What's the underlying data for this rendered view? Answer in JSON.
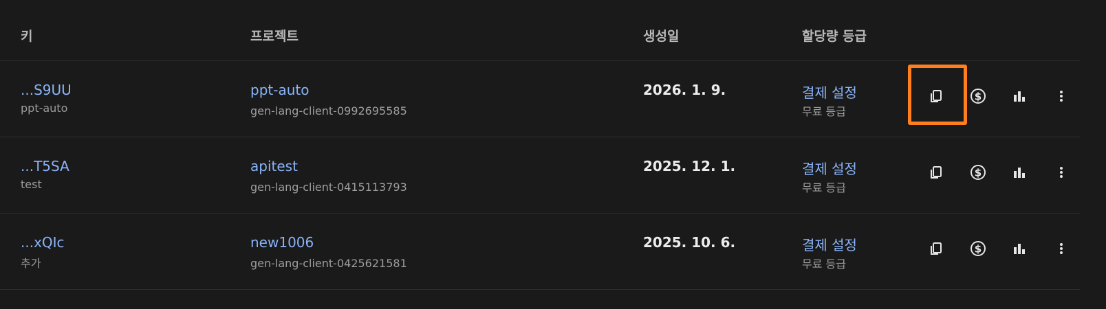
{
  "header": {
    "key": "키",
    "project": "프로젝트",
    "created": "생성일",
    "quota": "할당량 등급"
  },
  "rows": [
    {
      "key": "...S9UU",
      "key_name": "ppt-auto",
      "project": "ppt-auto",
      "project_id": "gen-lang-client-0992695585",
      "created": "2026. 1. 9.",
      "billing": "결제 설정",
      "tier": "무료 등급"
    },
    {
      "key": "...T5SA",
      "key_name": "test",
      "project": "apitest",
      "project_id": "gen-lang-client-0415113793",
      "created": "2025. 12. 1.",
      "billing": "결제 설정",
      "tier": "무료 등급"
    },
    {
      "key": "...xQIc",
      "key_name": "추가",
      "project": "new1006",
      "project_id": "gen-lang-client-0425621581",
      "created": "2025. 10. 6.",
      "billing": "결제 설정",
      "tier": "무료 등급"
    }
  ],
  "icons": [
    "copy-icon",
    "dollar-circle-icon",
    "bar-chart-icon",
    "more-vert-icon"
  ],
  "colors": {
    "background": "#1a1a1a",
    "link": "#8ab4f8",
    "highlight": "#ff7f1f"
  }
}
